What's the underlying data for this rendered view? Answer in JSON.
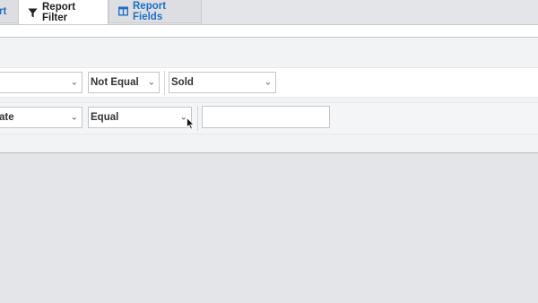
{
  "tabs": [
    {
      "label": "rt"
    },
    {
      "label": "Report Filter",
      "icon": "filter-icon"
    },
    {
      "label": "Report Fields",
      "icon": "columns-icon"
    }
  ],
  "filter_rows": [
    {
      "field": "",
      "operator": "Not Equal",
      "value": "Sold"
    },
    {
      "field": "ate",
      "operator": "Equal",
      "value": ""
    }
  ],
  "colors": {
    "link": "#1f6fc5",
    "background": "#e4e5e8"
  }
}
